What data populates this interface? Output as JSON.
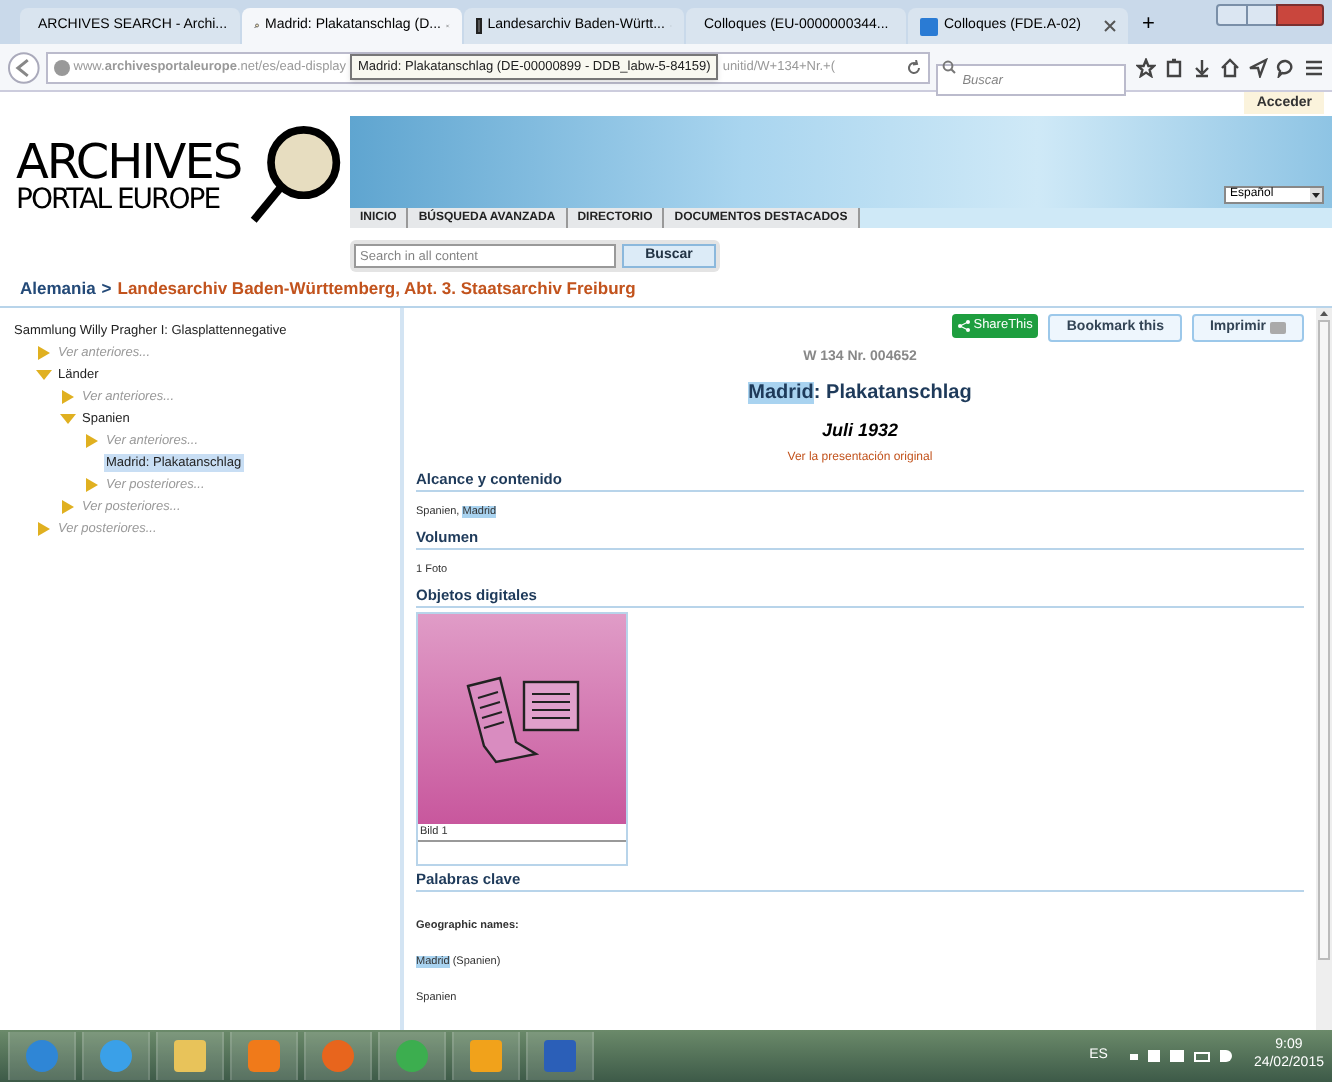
{
  "browser": {
    "tabs": [
      {
        "label": "ARCHIVES SEARCH - Archi...",
        "selected": false
      },
      {
        "label": "Madrid: Plakatanschlag (D...",
        "selected": true
      },
      {
        "label": "Landesarchiv Baden-Württ...",
        "selected": false
      },
      {
        "label": "Colloques (EU-0000000344...",
        "selected": false
      },
      {
        "label": "Colloques (FDE.A-02)",
        "selected": false
      }
    ],
    "new_tab": "+",
    "address": "www.**archivesportaleurope**.net/es/ead-display",
    "address_tail": "unitid/W+134+Nr.+(",
    "tooltip": "Madrid: Plakatanschlag (DE-00000899 - DDB_labw-5-84159)",
    "search_placeholder": "Buscar"
  },
  "site": {
    "login": "Acceder",
    "logo_line1": "ARCHIVES",
    "logo_line2": "PORTAL EUROPE",
    "language": "Español",
    "nav": [
      "INICIO",
      "BÚSQUEDA AVANZADA",
      "DIRECTORIO",
      "DOCUMENTOS DESTACADOS"
    ],
    "search_placeholder": "Search in all content",
    "search_button": "Buscar",
    "breadcrumb": [
      "Alemania",
      "Landesarchiv Baden-Württemberg, Abt. 3. Staatsarchiv Freiburg"
    ],
    "breadcrumb_separator": ">"
  },
  "tree": {
    "label": "Sammlung Willy Pragher I: Glasplattennegative",
    "kind": "root",
    "children": [
      {
        "label": "Ver anteriores...",
        "kind": "more"
      },
      {
        "label": "Länder",
        "kind": "node",
        "expanded": true,
        "children": [
          {
            "label": "Ver anteriores...",
            "kind": "more"
          },
          {
            "label": "Spanien",
            "kind": "node",
            "expanded": true,
            "children": [
              {
                "label": "Ver anteriores...",
                "kind": "more"
              },
              {
                "label": "Madrid: Plakatanschlag",
                "kind": "leaf",
                "selected": true
              },
              {
                "label": "Ver posteriores...",
                "kind": "more"
              }
            ]
          },
          {
            "label": "Ver posteriores...",
            "kind": "more"
          }
        ]
      },
      {
        "label": "Ver posteriores...",
        "kind": "more"
      }
    ]
  },
  "detail": {
    "share": "ShareThis",
    "bookmark": "Bookmark this",
    "print": "Imprimir",
    "reference": "W 134 Nr. 004652",
    "title": [
      {
        "text": "Madrid",
        "highlighted": true
      },
      {
        "text": ": Plakatanschlag",
        "highlighted": false
      }
    ],
    "date": "Juli 1932",
    "original_link": "Ver la presentación original",
    "sections": [
      {
        "heading": "Alcance y contenido",
        "kind": "text",
        "body": [
          {
            "text": "Spanien, ",
            "highlighted": false
          },
          {
            "text": "Madrid",
            "highlighted": true
          }
        ]
      },
      {
        "heading": "Volumen",
        "kind": "text",
        "body": [
          {
            "text": "1 Foto",
            "highlighted": false
          }
        ]
      },
      {
        "heading": "Objetos digitales",
        "kind": "images",
        "images": [
          {
            "caption": "Bild 1"
          }
        ]
      },
      {
        "heading": "Palabras clave",
        "kind": "keywords",
        "label": "Geographic names:",
        "lines": [
          [
            {
              "text": "Madrid",
              "highlighted": true
            },
            {
              "text": " (Spanien)",
              "highlighted": false
            }
          ],
          [
            {
              "text": "Spanien",
              "highlighted": false
            }
          ]
        ]
      }
    ]
  },
  "taskbar": {
    "language": "ES",
    "time": "9:09",
    "date": "24/02/2015"
  }
}
